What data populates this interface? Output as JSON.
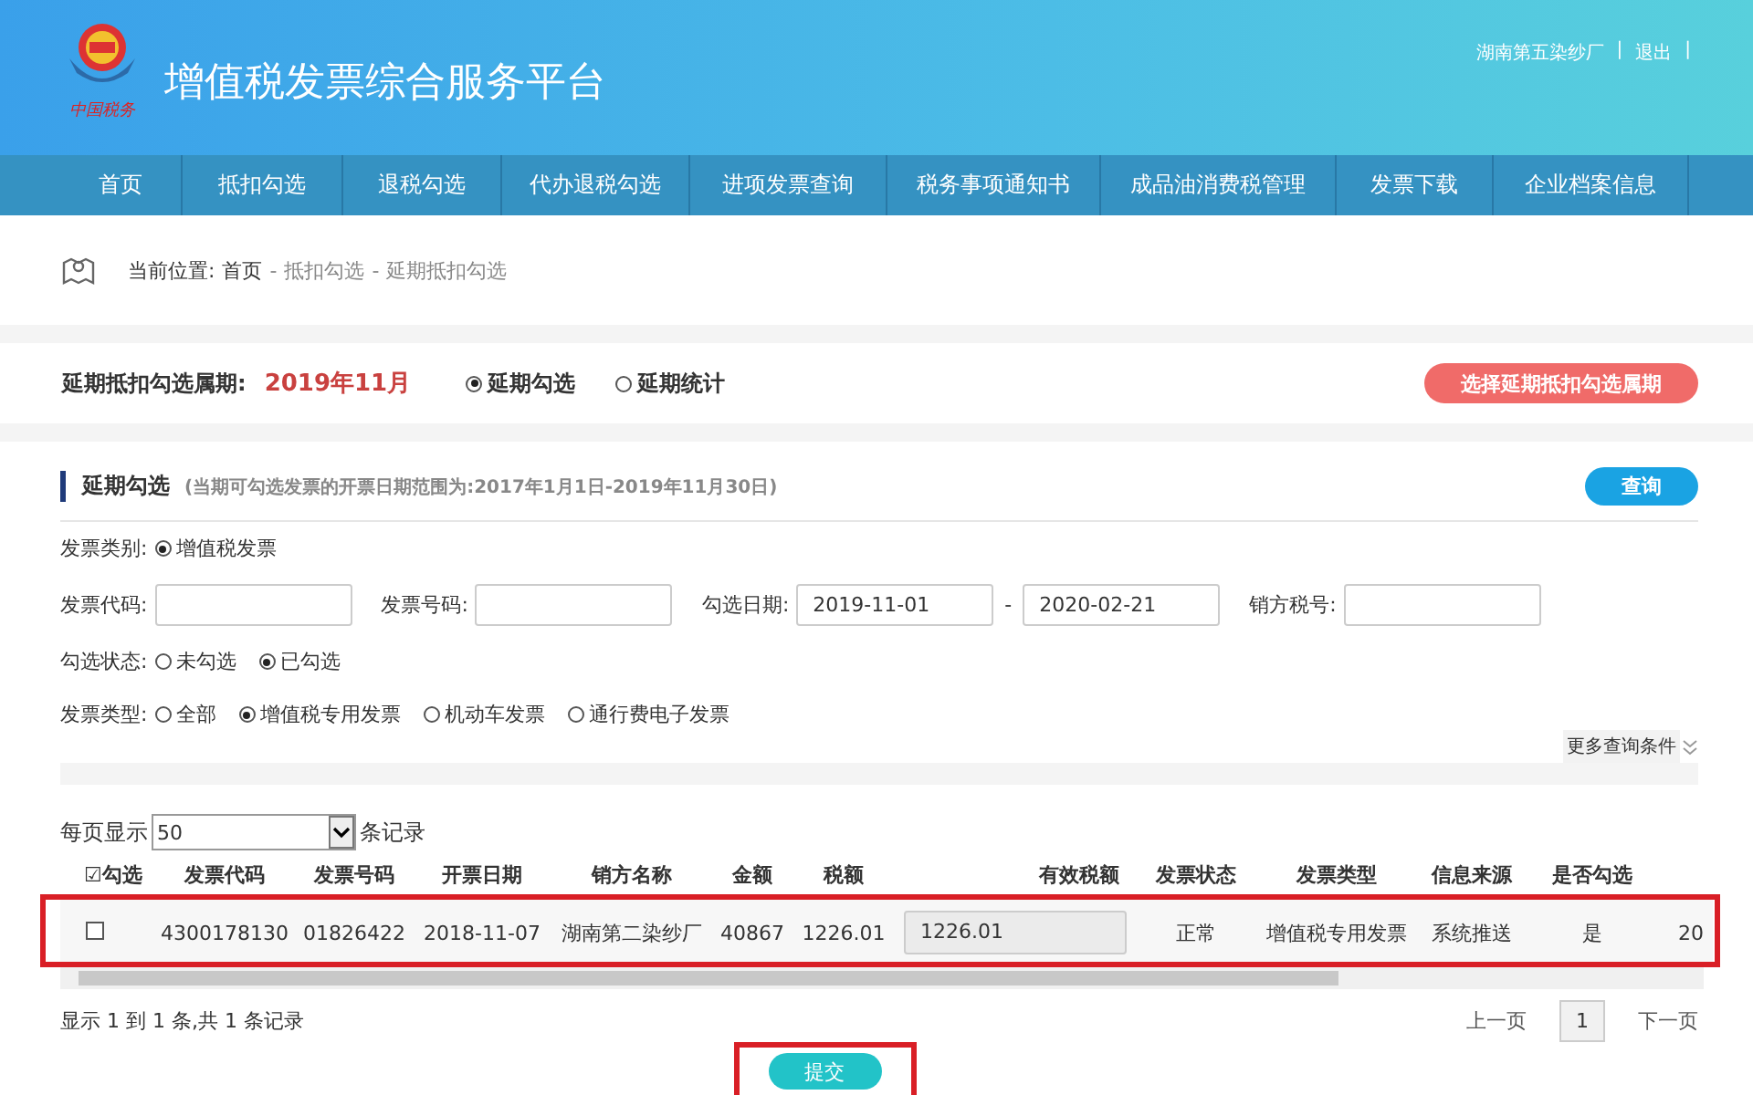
{
  "header": {
    "title": "增值税发票综合服务平台",
    "logo_caption": "中国税务",
    "user": "湖南第五染纱厂",
    "logout": "退出",
    "separators": [
      "|",
      "|"
    ]
  },
  "nav": [
    {
      "label": "首页",
      "selected": false
    },
    {
      "label": "抵扣勾选",
      "selected": false
    },
    {
      "label": "退税勾选",
      "selected": false
    },
    {
      "label": "代办退税勾选",
      "selected": false
    },
    {
      "label": "进项发票查询",
      "selected": false
    },
    {
      "label": "税务事项通知书",
      "selected": false
    },
    {
      "label": "成品油消费税管理",
      "selected": false
    },
    {
      "label": "发票下载",
      "selected": false
    },
    {
      "label": "企业档案信息",
      "selected": false
    }
  ],
  "breadcrumb": {
    "label": "当前位置:",
    "items": [
      "首页",
      "抵扣勾选",
      "延期抵扣勾选"
    ],
    "separators": [
      "-",
      "-"
    ]
  },
  "period": {
    "label": "延期抵扣勾选属期:",
    "value": "2019年11月",
    "options": [
      {
        "label": "延期勾选",
        "selected": true
      },
      {
        "label": "延期统计",
        "selected": false
      }
    ],
    "button": "选择延期抵扣勾选属期"
  },
  "panel": {
    "title": "延期勾选",
    "note": "(当期可勾选发票的开票日期范围为:2017年1月1日-2019年11月30日)",
    "query_button": "查询",
    "filters": [
      {
        "kind": "radio",
        "label": "发票类别:",
        "options": [
          {
            "label": "增值税发票",
            "selected": true
          }
        ]
      },
      {
        "kind": "fields",
        "fields": [
          {
            "label": "发票代码:"
          },
          {
            "label": "发票号码:"
          },
          {
            "label": "勾选日期:",
            "value": "2019-11-01",
            "separator": "-",
            "to": "2020-02-21"
          },
          {
            "label": "销方税号:"
          }
        ]
      },
      {
        "kind": "radio",
        "label": "勾选状态:",
        "options": [
          {
            "label": "未勾选",
            "selected": false
          },
          {
            "label": "已勾选",
            "selected": true
          }
        ]
      },
      {
        "kind": "radio",
        "label": "发票类型:",
        "options": [
          {
            "label": "全部",
            "selected": false
          },
          {
            "label": "增值税专用发票",
            "selected": true
          },
          {
            "label": "机动车发票",
            "selected": false
          },
          {
            "label": "通行费电子发票",
            "selected": false
          }
        ]
      }
    ],
    "more": "更多查询条件"
  },
  "page_size": {
    "label": "每页显示",
    "value": "50",
    "suffix": "条记录"
  },
  "table": {
    "columns": [
      "☑勾选",
      "发票代码",
      "发票号码",
      "开票日期",
      "销方名称",
      "金额",
      "税额",
      "有效税额",
      "发票状态",
      "发票类型",
      "信息来源",
      "是否勾选",
      ""
    ],
    "rows": [
      {
        "checked": false,
        "highlighted": true,
        "cells": [
          "",
          "4300178130",
          "01826422",
          "2018-11-07",
          "湖南第二染纱厂",
          "40867",
          "1226.01",
          "1226.01",
          "正常",
          "增值税专用发票",
          "系统推送",
          "是",
          "20"
        ]
      }
    ]
  },
  "summary": "显示 1 到 1 条,共 1 条记录",
  "pager": {
    "prev": "上一页",
    "pages": [
      {
        "label": "1",
        "selected": true
      }
    ],
    "next": "下一页"
  },
  "submit": {
    "label": "提交",
    "highlighted": true
  }
}
